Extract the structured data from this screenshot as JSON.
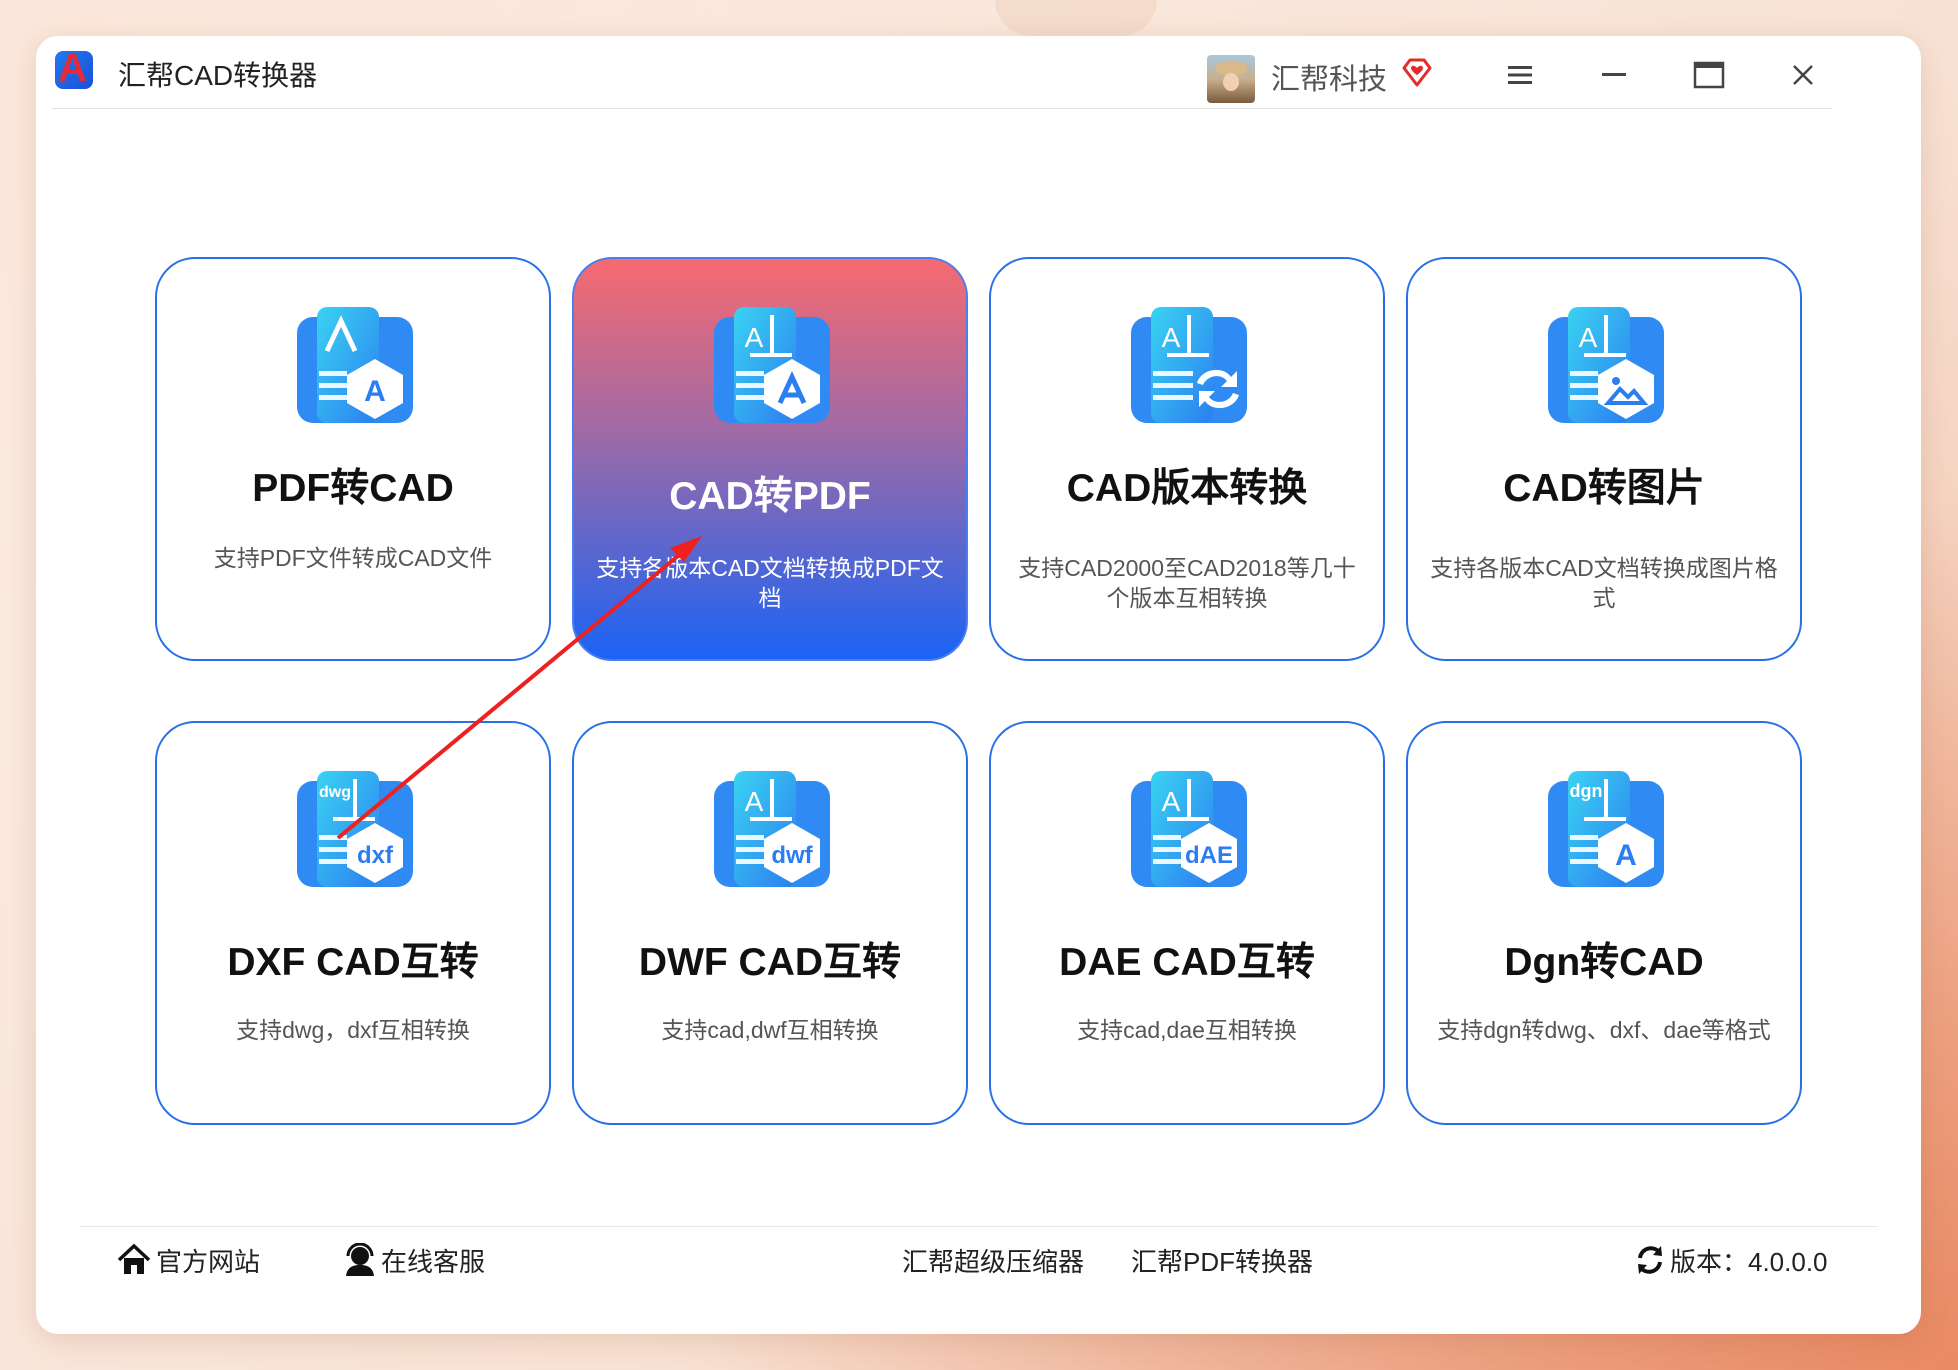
{
  "app": {
    "title": "汇帮CAD转换器",
    "logo_letter": "A",
    "user_name": "汇帮科技",
    "vip_icon": "diamond-heart-icon",
    "accent": "#2770e6",
    "active_gradient": [
      "#f76a70",
      "#1b63f5"
    ]
  },
  "window_controls": {
    "menu": "hamburger-menu-icon",
    "minimize": "minimize-icon",
    "maximize": "maximize-icon",
    "close": "close-icon"
  },
  "cards": [
    {
      "title": "PDF转CAD",
      "desc": "支持PDF文件转成CAD文件",
      "icon": "pdf-to-cad-icon",
      "badge": "A",
      "active": false
    },
    {
      "title": "CAD转PDF",
      "desc": "支持各版本CAD文档转换成PDF文档",
      "icon": "cad-to-pdf-icon",
      "badge": "A",
      "active": true
    },
    {
      "title": "CAD版本转换",
      "desc": "支持CAD2000至CAD2018等几十个版本互相转换",
      "icon": "cad-version-convert-icon",
      "badge": "",
      "active": false
    },
    {
      "title": "CAD转图片",
      "desc": "支持各版本CAD文档转换成图片格式",
      "icon": "cad-to-image-icon",
      "badge": "",
      "active": false
    },
    {
      "title": "DXF CAD互转",
      "desc": "支持dwg，dxf互相转换",
      "icon": "dxf-cad-icon",
      "badge": "dxf",
      "small": "dwg",
      "active": false
    },
    {
      "title": "DWF CAD互转",
      "desc": "支持cad,dwf互相转换",
      "icon": "dwf-cad-icon",
      "badge": "dwf",
      "active": false
    },
    {
      "title": "DAE CAD互转",
      "desc": "支持cad,dae互相转换",
      "icon": "dae-cad-icon",
      "badge": "dAE",
      "active": false
    },
    {
      "title": "Dgn转CAD",
      "desc": "支持dgn转dwg、dxf、dae等格式",
      "icon": "dgn-to-cad-icon",
      "badge": "A",
      "small": "dgn",
      "active": false
    }
  ],
  "footer": {
    "website": "官方网站",
    "support": "在线客服",
    "compressor": "汇帮超级压缩器",
    "pdf_converter": "汇帮PDF转换器",
    "version": "版本：4.0.0.0"
  }
}
